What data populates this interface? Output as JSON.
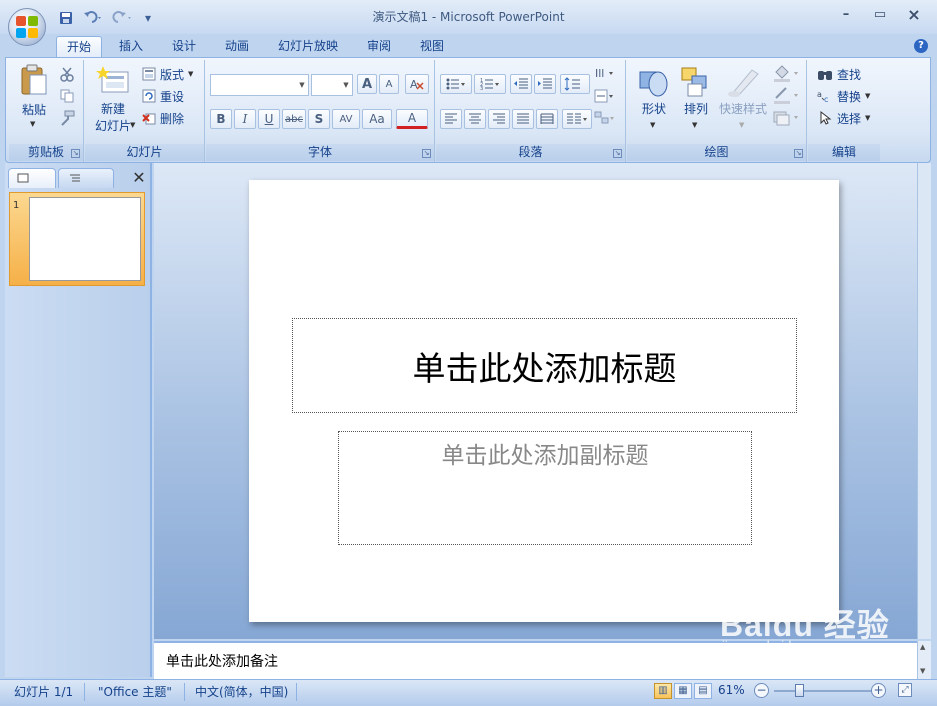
{
  "window": {
    "title": "演示文稿1 - Microsoft PowerPoint",
    "minimize": "–",
    "maximize": "▭",
    "close": "×"
  },
  "qat": {
    "save_icon": "save-icon",
    "undo_icon": "undo-icon",
    "redo_icon": "redo-icon",
    "customize": "▾"
  },
  "tabs": [
    {
      "label": "开始"
    },
    {
      "label": "插入"
    },
    {
      "label": "设计"
    },
    {
      "label": "动画"
    },
    {
      "label": "幻灯片放映"
    },
    {
      "label": "审阅"
    },
    {
      "label": "视图"
    }
  ],
  "help": "?",
  "ribbon": {
    "clipboard": {
      "label": "剪贴板",
      "paste": "粘贴"
    },
    "slides": {
      "label": "幻灯片",
      "new_slide_line1": "新建",
      "new_slide_line2": "幻灯片",
      "layout": "版式",
      "reset": "重设",
      "delete": "删除"
    },
    "font": {
      "label": "字体",
      "bold": "B",
      "italic": "I",
      "underline": "U",
      "strike": "abc",
      "shadow": "S",
      "spacing": "AV",
      "case": "Aa",
      "color": "A",
      "grow": "A",
      "shrink": "A"
    },
    "paragraph": {
      "label": "段落"
    },
    "drawing": {
      "label": "绘图",
      "shapes": "形状",
      "arrange": "排列",
      "quick_styles": "快速样式"
    },
    "editing": {
      "label": "编辑",
      "find": "查找",
      "replace": "替换",
      "select": "选择"
    }
  },
  "panel": {
    "close": "✕",
    "slide_number": "1"
  },
  "slide": {
    "title_placeholder": "单击此处添加标题",
    "subtitle_placeholder": "单击此处添加副标题"
  },
  "notes": {
    "placeholder": "单击此处添加备注"
  },
  "status": {
    "slide": "幻灯片 1/1",
    "theme": "\"Office 主题\"",
    "language": "中文(简体，中国)",
    "zoom": "61%",
    "zoom_level": 61
  },
  "watermark": {
    "logo": "Baidu 经验",
    "url": "jingyan.baidu.com"
  }
}
